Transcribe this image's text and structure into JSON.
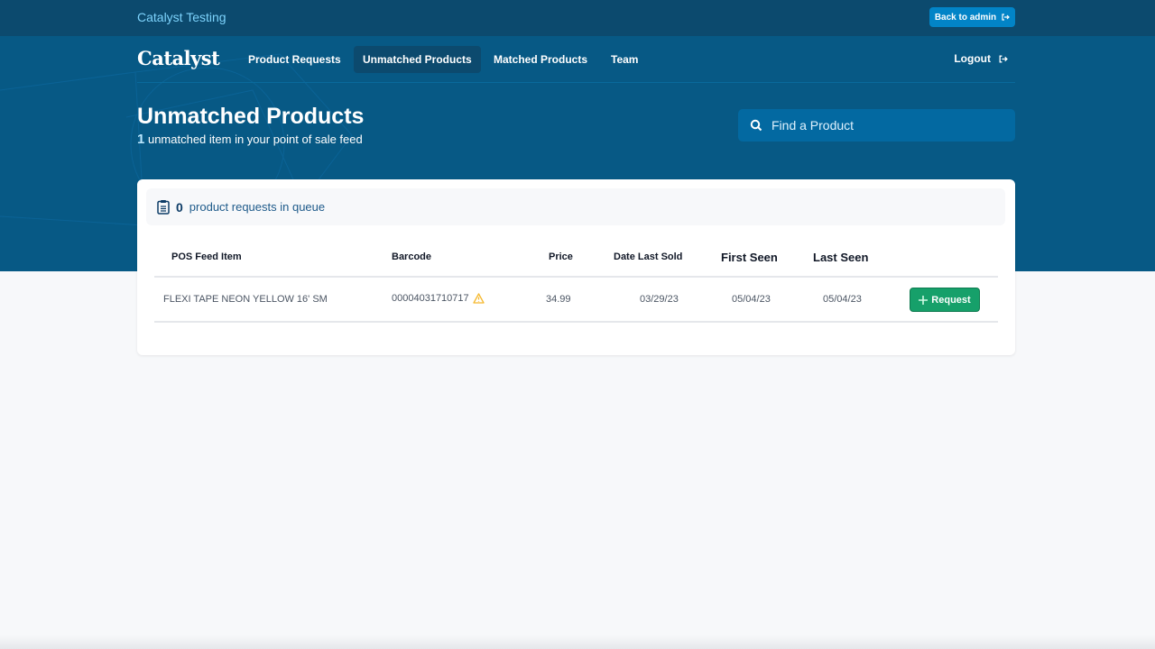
{
  "topbar": {
    "org_name": "Catalyst Testing",
    "back_label": "Back to admin",
    "back_icon": "exit-arrow-icon"
  },
  "nav": {
    "logo": "Catalyst",
    "items": [
      {
        "label": "Product Requests",
        "active": false
      },
      {
        "label": "Unmatched Products",
        "active": true
      },
      {
        "label": "Matched Products",
        "active": false
      },
      {
        "label": "Team",
        "active": false
      }
    ],
    "logout_label": "Logout",
    "logout_icon": "exit-arrow-icon"
  },
  "header": {
    "title": "Unmatched Products",
    "count": "1",
    "subtitle": "unmatched item in your point of sale feed"
  },
  "search": {
    "placeholder": "Find a Product",
    "value": "",
    "icon": "search-icon"
  },
  "queue": {
    "icon": "clipboard-icon",
    "count": "0",
    "label": "product requests in queue"
  },
  "table": {
    "columns": [
      "POS Feed Item",
      "Barcode",
      "Price",
      "Date Last Sold",
      "First Seen",
      "Last Seen"
    ],
    "rows": [
      {
        "item": "FLEXI TAPE NEON YELLOW 16' SM",
        "barcode": "00004031710717",
        "barcode_warning": "warning-triangle-icon",
        "price": "34.99",
        "date_last_sold": "03/29/23",
        "first_seen": "05/04/23",
        "last_seen": "05/04/23",
        "action_label": "Request"
      }
    ]
  },
  "colors": {
    "topbar": "#0c4a6e",
    "hero": "#075985",
    "accent": "#0284c7",
    "request_button": "#16a06a",
    "warning": "#f5b82e"
  }
}
